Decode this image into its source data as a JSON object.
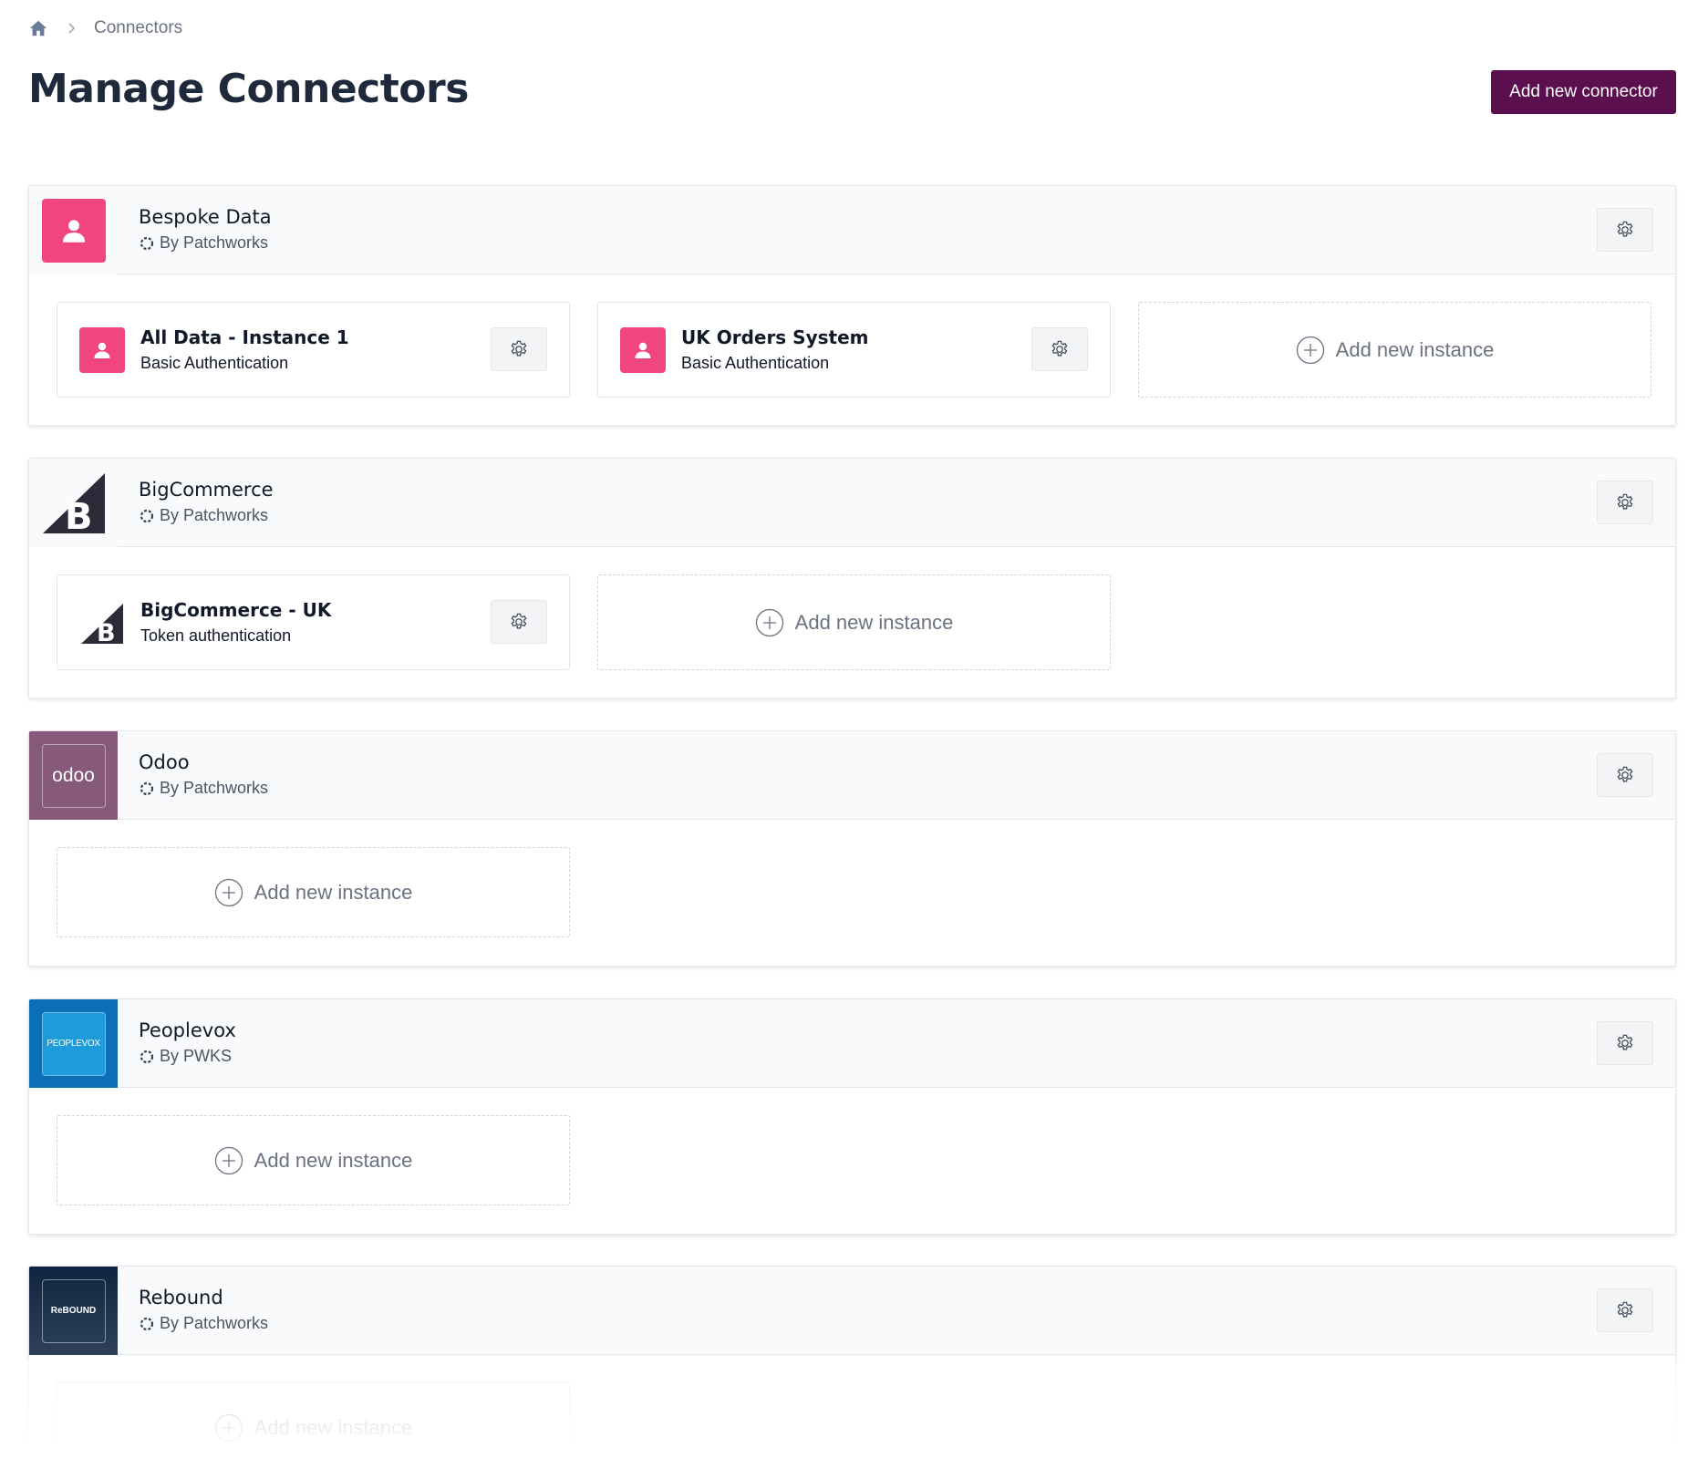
{
  "breadcrumb": {
    "home_icon": "home-icon",
    "current": "Connectors"
  },
  "header": {
    "title": "Manage Connectors",
    "add_button_label": "Add new connector"
  },
  "colors": {
    "primary": "#5c0f4e",
    "bespoke_pink": "#f0457f",
    "odoo_purple": "#875a7b",
    "peoplevox_blue": "#0a6fb5",
    "rebound_navy": "#0f2440"
  },
  "add_instance_label": "Add new instance",
  "connectors": [
    {
      "name": "Bespoke Data",
      "by": "By Patchworks",
      "logo": "person-icon",
      "instances": [
        {
          "name": "All Data - Instance 1",
          "auth": "Basic Authentication"
        },
        {
          "name": "UK Orders System",
          "auth": "Basic Authentication"
        }
      ]
    },
    {
      "name": "BigCommerce",
      "by": "By Patchworks",
      "logo": "bigcommerce-logo",
      "instances": [
        {
          "name": "BigCommerce - UK",
          "auth": "Token authentication"
        }
      ]
    },
    {
      "name": "Odoo",
      "by": "By Patchworks",
      "logo": "odoo-logo",
      "logo_text": "odoo",
      "instances": []
    },
    {
      "name": "Peoplevox",
      "by": "By PWKS",
      "logo": "peoplevox-logo",
      "logo_text": "PEOPLEVOX",
      "instances": []
    },
    {
      "name": "Rebound",
      "by": "By Patchworks",
      "logo": "rebound-logo",
      "logo_text": "ReBOUND",
      "instances": []
    }
  ]
}
